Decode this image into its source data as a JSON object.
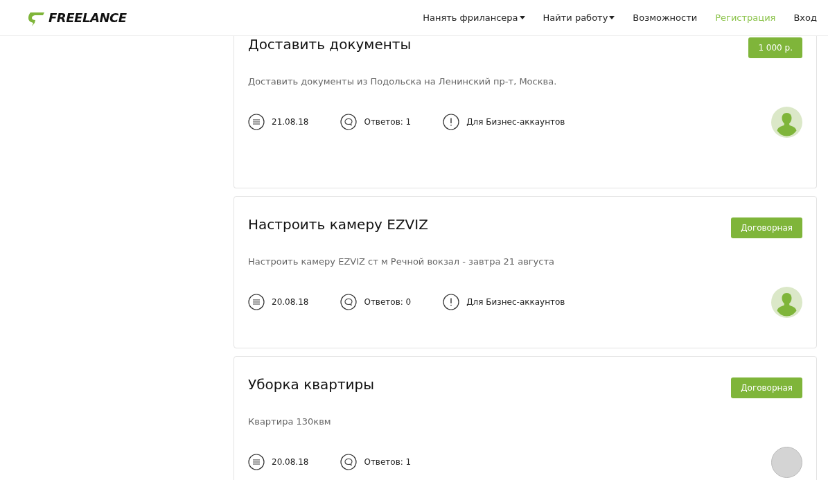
{
  "header": {
    "logo": "FREELANCE",
    "nav": [
      {
        "label": "Нанять фрилансера",
        "dropdown": true,
        "highlight": false
      },
      {
        "label": "Найти работу",
        "dropdown": true,
        "highlight": false
      },
      {
        "label": "Возможности",
        "dropdown": false,
        "highlight": false
      },
      {
        "label": "Регистрация",
        "dropdown": false,
        "highlight": true
      },
      {
        "label": "Вход",
        "dropdown": false,
        "highlight": false
      }
    ]
  },
  "tasks": [
    {
      "title": "Доставить документы",
      "price": "1 000 р.",
      "description": "Доставить документы из Подольска на Ленинский пр-т, Москва.",
      "date": "21.08.18",
      "answers": "Ответов: 1",
      "business": "Для Бизнес-аккаунтов",
      "avatar": {
        "kind": "default"
      }
    },
    {
      "title": "Настроить камеру EZVIZ",
      "price": "Договорная",
      "description": "Настроить камеру EZVIZ ст м Речной вокзал - завтра 21 августа",
      "date": "20.08.18",
      "answers": "Ответов: 0",
      "business": "Для Бизнес-аккаунтов",
      "avatar": {
        "kind": "default"
      }
    },
    {
      "title": "Уборка квартиры",
      "price": "Договорная",
      "description": "Квартира 130квм",
      "date": "20.08.18",
      "answers": "Ответов: 1",
      "avatar": {
        "kind": "photo"
      }
    }
  ]
}
